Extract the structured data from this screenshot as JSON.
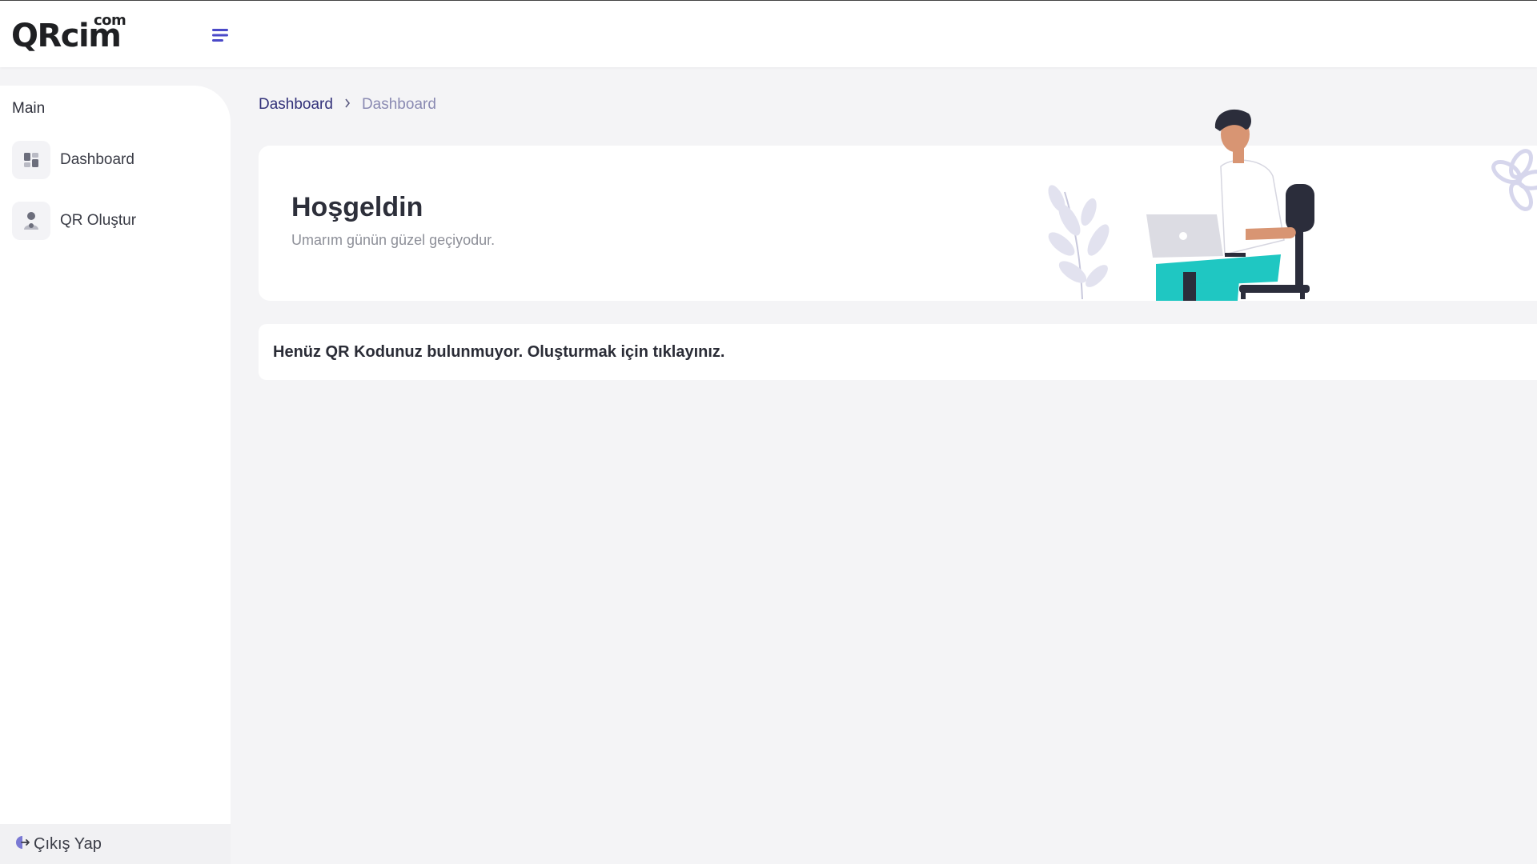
{
  "header": {
    "logo_text": "QRcim",
    "logo_superscript": "com",
    "menu_icon": "hamburger-menu-icon"
  },
  "sidebar": {
    "heading": "Main",
    "items": [
      {
        "label": "Dashboard",
        "icon": "dashboard-icon"
      },
      {
        "label": "QR Oluştur",
        "icon": "user-icon"
      }
    ],
    "logout": {
      "label": "Çıkış Yap",
      "icon": "logout-icon"
    }
  },
  "breadcrumb": {
    "items": [
      "Dashboard",
      "Dashboard"
    ]
  },
  "welcome": {
    "title": "Hoşgeldin",
    "subtitle": "Umarım günün güzel geçiyodur."
  },
  "notice": {
    "text": "Henüz QR Kodunuz bulunmuyor. Oluşturmak için tıklayınız."
  },
  "colors": {
    "accent": "#4a49c8",
    "breadcrumb_link": "#33327a",
    "breadcrumb_current": "#8a8ab2",
    "illustration_pants": "#1fc7c2",
    "page_background": "#f4f4f6"
  }
}
